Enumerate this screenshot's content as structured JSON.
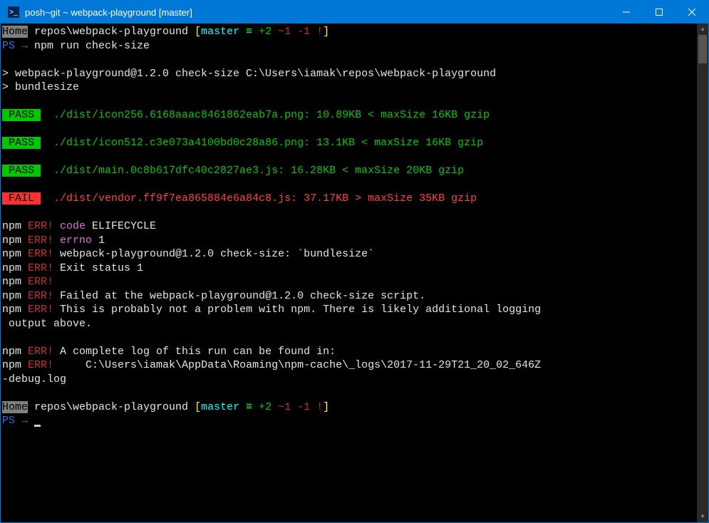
{
  "titlebar": {
    "title": "posh~git ~ webpack-playground [master]"
  },
  "prompt1": {
    "home": "Home",
    "path": " repos\\webpack-playground ",
    "branch_open": "[",
    "branch": "master",
    "equiv": " ≡ ",
    "plus": "+2",
    "tilde": " ~1",
    "minus": " -1",
    "bang": " !",
    "branch_close": "]",
    "ps": "PS",
    "arrow": " → ",
    "command": "npm run check-size"
  },
  "npm_header": {
    "line1": "> webpack-playground@1.2.0 check-size C:\\Users\\iamak\\repos\\webpack-playground",
    "line2": "> bundlesize"
  },
  "results": [
    {
      "status": " PASS ",
      "pass": true,
      "text": "  ./dist/icon256.6168aaac8461862eab7a.png: 10.89KB < maxSize 16KB gzip"
    },
    {
      "status": " PASS ",
      "pass": true,
      "text": "  ./dist/icon512.c3e073a4100bd0c28a86.png: 13.1KB < maxSize 16KB gzip"
    },
    {
      "status": " PASS ",
      "pass": true,
      "text": "  ./dist/main.0c8b617dfc40c2827ae3.js: 16.28KB < maxSize 20KB gzip"
    },
    {
      "status": " FAIL ",
      "pass": false,
      "text": "  ./dist/vendor.ff9f7ea865884e6a84c8.js: 37.17KB > maxSize 35KB gzip"
    }
  ],
  "errs": {
    "npm": "npm",
    "err": " ERR!",
    "code_label": " code",
    "code_val": " ELIFECYCLE",
    "errno_label": " errno",
    "errno_val": " 1",
    "l3": " webpack-playground@1.2.0 check-size: `bundlesize`",
    "l4": " Exit status 1",
    "l6": " Failed at the webpack-playground@1.2.0 check-size script.",
    "l7a": " This is probably not a problem with npm. There is likely additional logging",
    "l7b": " output above.",
    "l9": " A complete log of this run can be found in:",
    "l10a": "     C:\\Users\\iamak\\AppData\\Roaming\\npm-cache\\_logs\\2017-11-29T21_20_02_646Z",
    "l10b": "-debug.log"
  },
  "prompt2": {
    "home": "Home",
    "path": " repos\\webpack-playground ",
    "branch_open": "[",
    "branch": "master",
    "equiv": " ≡ ",
    "plus": "+2",
    "tilde": " ~1",
    "minus": " -1",
    "bang": " !",
    "branch_close": "]",
    "ps": "PS",
    "arrow": " → "
  }
}
